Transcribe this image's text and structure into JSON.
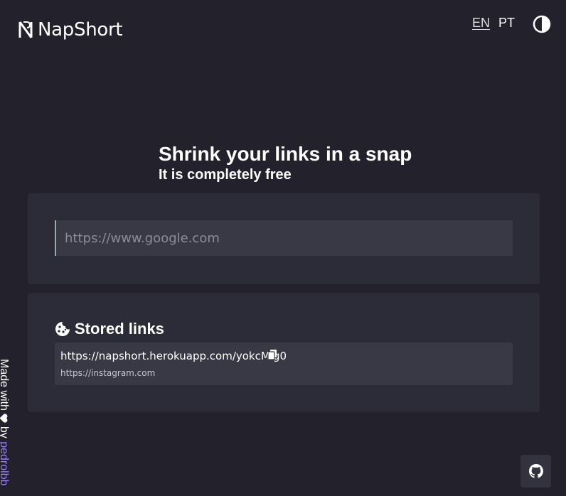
{
  "colors": {
    "background": "#23222c",
    "card": "#2c2c38",
    "input": "#393946",
    "link_accent": "#9b7cff"
  },
  "header": {
    "logo_text": "NapShort",
    "languages": [
      {
        "code": "EN",
        "active": true
      },
      {
        "code": "PT",
        "active": false
      }
    ],
    "theme_toggle_icon": "contrast-icon"
  },
  "hero": {
    "title": "Shrink your links in a snap",
    "subtitle": "It is completely free"
  },
  "shortener": {
    "placeholder": "https://www.google.com",
    "value": ""
  },
  "stored": {
    "icon": "cookie-icon",
    "title": "Stored links",
    "items": [
      {
        "short_url": "https://napshort.herokuapp.com/yokcMlg0",
        "original_url": "https://instagram.com",
        "copy_icon": "copy-icon"
      }
    ]
  },
  "footer": {
    "made_with": "Made with",
    "heart_icon": "heart-icon",
    "by": "by",
    "author": "pedrolbb",
    "github_icon": "github-icon"
  }
}
